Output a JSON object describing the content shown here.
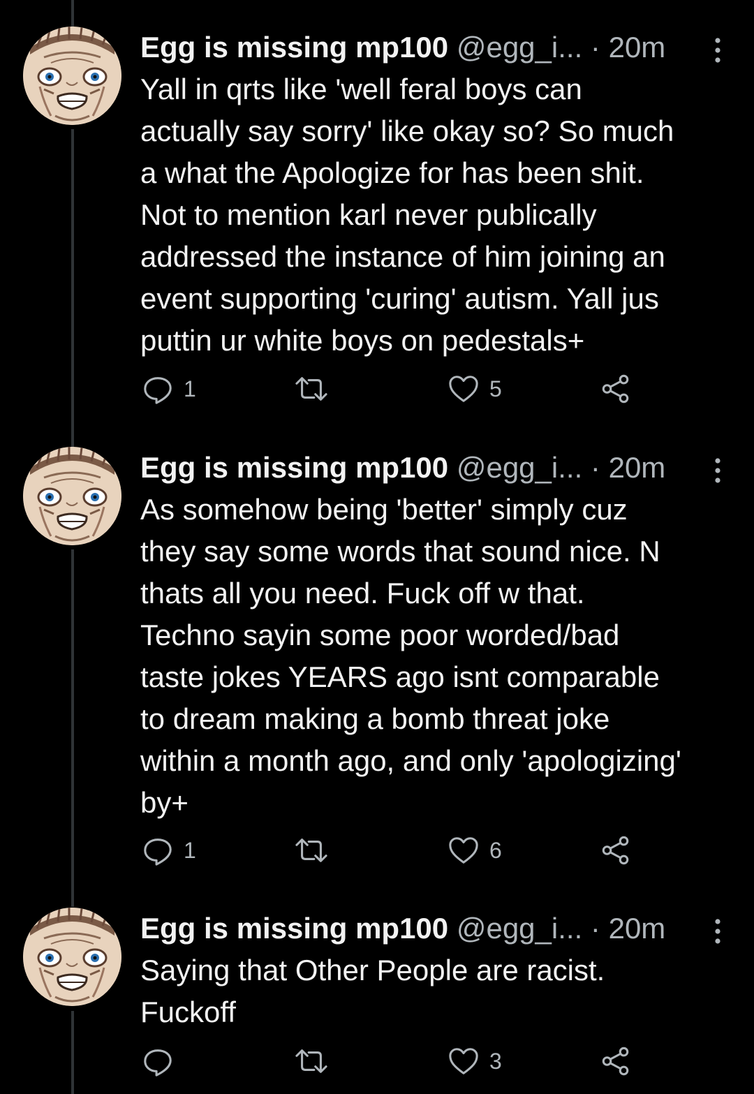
{
  "tweets": [
    {
      "name": "Egg is missing mp100",
      "handle": "@egg_i...",
      "dot": "·",
      "time": "20m",
      "lines": [
        "Yall in qrts like 'well feral boys can",
        "actually say sorry' like okay so? So much",
        "a what the Apologize for has been shit.",
        "Not to mention karl never publically",
        "addressed the instance of him joining an",
        "event supporting 'curing' autism. Yall jus",
        "puttin ur white boys on pedestals+"
      ],
      "reply_count": "1",
      "retweet_count": "",
      "like_count": "5"
    },
    {
      "name": "Egg is missing mp100",
      "handle": "@egg_i...",
      "dot": "·",
      "time": "20m",
      "lines": [
        "As somehow being 'better' simply cuz",
        "they say some words that sound nice. N",
        "thats all you need. Fuck off w that.",
        "Techno sayin some poor worded/bad",
        "taste jokes YEARS ago isnt comparable",
        "to dream making a bomb threat joke",
        "within a month ago, and only 'apologizing'",
        "by+"
      ],
      "reply_count": "1",
      "retweet_count": "",
      "like_count": "6"
    },
    {
      "name": "Egg is missing mp100",
      "handle": "@egg_i...",
      "dot": "·",
      "time": "20m",
      "lines": [
        "Saying that Other People are racist.",
        "Fuckoff"
      ],
      "reply_count": "",
      "retweet_count": "",
      "like_count": "3"
    }
  ],
  "icons": {
    "reply": "reply-icon",
    "retweet": "retweet-icon",
    "like": "heart-icon",
    "share": "share-icon",
    "more": "more-vertical-icon"
  },
  "colors": {
    "background": "#000000",
    "text": "#f2f2f2",
    "secondary": "#b0b6bb",
    "thread_line": "#2f3336"
  }
}
